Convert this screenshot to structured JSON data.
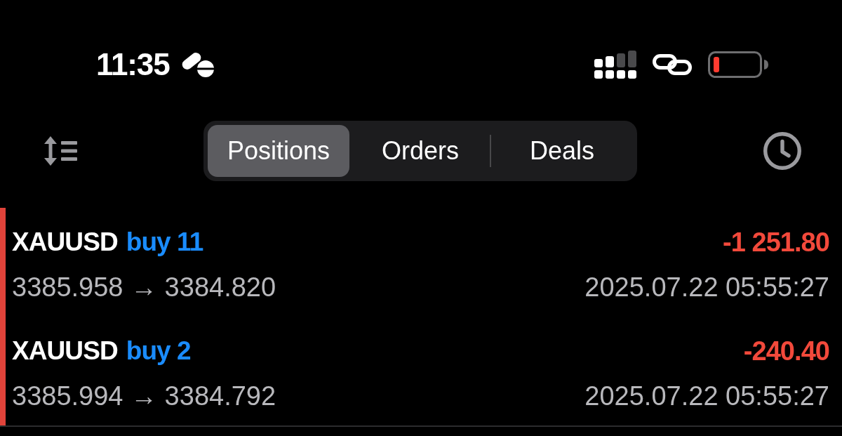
{
  "status_bar": {
    "time": "11:35"
  },
  "toolbar": {
    "tabs": [
      {
        "label": "Positions",
        "selected": true
      },
      {
        "label": "Orders",
        "selected": false
      },
      {
        "label": "Deals",
        "selected": false
      }
    ]
  },
  "positions": [
    {
      "symbol": "XAUUSD",
      "order": "buy 11",
      "prices": "3385.958 → 3384.820",
      "profit": "-1 251.80",
      "time": "2025.07.22 05:55:27",
      "color": "#e0433a"
    },
    {
      "symbol": "XAUUSD",
      "order": "buy 2",
      "prices": "3385.994 → 3384.792",
      "profit": "-240.40",
      "time": "2025.07.22 05:55:27",
      "color": "#e0433a"
    }
  ]
}
